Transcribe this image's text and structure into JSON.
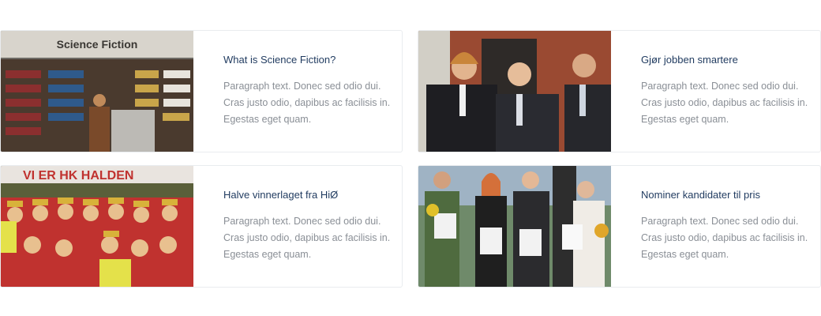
{
  "cards": [
    {
      "title": "What is Science Fiction?",
      "body": "Paragraph text. Donec sed odio dui. Cras justo odio, dapibus ac facilisis in. Egestas eget quam.",
      "image_caption": "Science Fiction"
    },
    {
      "title": "Gjør jobben smartere",
      "body": "Paragraph text. Donec sed odio dui. Cras justo odio, dapibus ac facilisis in. Egestas eget quam."
    },
    {
      "title": "Halve vinnerlaget fra HiØ",
      "body": "Paragraph text. Donec sed odio dui. Cras justo odio, dapibus ac facilisis in. Egestas eget quam.",
      "image_caption": "VI ER HK HALDEN"
    },
    {
      "title": "Nominer kandidater til pris",
      "body": "Paragraph text. Donec sed odio dui. Cras justo odio, dapibus ac facilisis in. Egestas eget quam."
    }
  ],
  "colors": {
    "title": "#1f3a5f",
    "body_text": "#8a8f96",
    "card_border": "#e9ecef"
  }
}
